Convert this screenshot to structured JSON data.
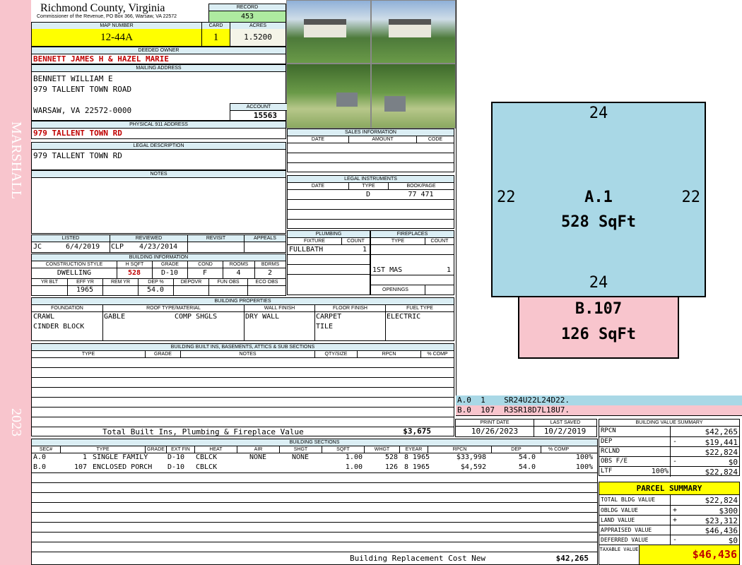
{
  "sidebar": {
    "owner_name": "MARSHALL",
    "year": "2023"
  },
  "header": {
    "county": "Richmond County, Virginia",
    "commissioner": "Commissioner of the Revenue, PO Box 366, Warsaw, VA 22572",
    "record_label": "RECORD",
    "record": "453",
    "map_number_label": "MAP NUMBER",
    "map_number": "12-44A",
    "card_label": "CARD",
    "card": "1",
    "acres_label": "ACRES",
    "acres": "1.5200"
  },
  "owner": {
    "deeded_owner_label": "DEEDED OWNER",
    "deeded_owner": "BENNETT JAMES H & HAZEL MARIE",
    "mailing_address_label": "MAILING ADDRESS",
    "mailing_line1": "BENNETT WILLIAM E",
    "mailing_line2": "979 TALLENT TOWN ROAD",
    "mailing_line3": "WARSAW, VA 22572-0000",
    "account_label": "ACCOUNT",
    "account": "15563",
    "physical_address_label": "PHYSICAL 911 ADDRESS",
    "physical_address": "979 TALLENT TOWN RD",
    "legal_description_label": "LEGAL DESCRIPTION",
    "legal_description": "979 TALLENT TOWN RD",
    "notes_label": "NOTES"
  },
  "sales": {
    "label": "SALES INFORMATION",
    "columns": [
      "DATE",
      "AMOUNT",
      "CODE"
    ]
  },
  "legal_instruments": {
    "label": "LEGAL INSTRUMENTS",
    "columns": [
      "DATE",
      "TYPE",
      "BOOK/PAGE"
    ],
    "row": {
      "date": "",
      "type": "D",
      "bookpage": "77 471"
    }
  },
  "review": {
    "listed_label": "LISTED",
    "reviewed_label": "REVIEWED",
    "revisit_label": "REVISIT",
    "appeals_label": "APPEALS",
    "listed_by": "JC",
    "listed_date": "6/4/2019",
    "reviewed_by": "CLP",
    "reviewed_date": "4/23/2014"
  },
  "building_info": {
    "label": "BUILDING INFORMATION",
    "cols1": [
      "CONSTRUCTION STYLE",
      "H SQFT",
      "GRADE",
      "COND",
      "ROOMS",
      "BDRMS"
    ],
    "style": "DWELLING",
    "hsqft": "528",
    "grade": "D-10",
    "cond": "F",
    "rooms": "4",
    "bdrms": "2",
    "cols2": [
      "YR BLT",
      "EFF YR",
      "REM YR",
      "DEP %",
      "DEPOVR",
      "FUN OBS",
      "ECO OBS"
    ],
    "eff_yr": "1965",
    "dep": "54.0"
  },
  "plumbing": {
    "label": "PLUMBING",
    "fixture_label": "FIXTURE",
    "count_label": "COUNT",
    "fixture": "FULLBATH",
    "count": "1"
  },
  "fireplaces": {
    "label": "FIREPLACES",
    "type_label": "TYPE",
    "count_label": "COUNT",
    "type": "1ST MAS",
    "count": "1",
    "openings_label": "OPENINGS"
  },
  "properties": {
    "label": "BUILDING PROPERTIES",
    "columns": [
      "FOUNDATION",
      "ROOF TYPE/MATERIAL",
      "WALL FINISH",
      "FLOOR FINISH",
      "FUEL TYPE"
    ],
    "foundation1": "CRAWL",
    "foundation2": "CINDER BLOCK",
    "roof_type": "GABLE",
    "roof_material": "COMP SHGLS",
    "wall": "DRY WALL",
    "floor1": "CARPET",
    "floor2": "TILE",
    "fuel": "ELECTRIC"
  },
  "builtins": {
    "label": "BUILDING BUILT INS, BASEMENTS, ATTICS & SUB SECTIONS",
    "columns": [
      "TYPE",
      "GRADE",
      "NOTES",
      "QTY/SIZE",
      "RPCN",
      "% COMP"
    ],
    "total_label": "Total Built Ins, Plumbing & Fireplace Value",
    "total_value": "$3,675"
  },
  "sections": {
    "label": "BUILDING SECTIONS",
    "columns": [
      "SEC#",
      "TYPE",
      "GRADE",
      "EXT FIN",
      "HEAT",
      "AIR",
      "SHGT",
      "SQFT",
      "WHGT",
      "EYEAR",
      "RPCN",
      "DEP",
      "% COMP"
    ],
    "rows": [
      {
        "sec": "A.0",
        "num": "1",
        "type": "SINGLE FAMILY",
        "grade": "D-10",
        "ext": "CBLCK",
        "heat": "NONE",
        "air": "NONE",
        "shgt": "1.00",
        "sqft": "528",
        "whgt": "8",
        "eyear": "1965",
        "rpcn": "$33,998",
        "dep": "54.0",
        "comp": "100%"
      },
      {
        "sec": "B.0",
        "num": "107",
        "type": "ENCLOSED PORCH",
        "grade": "D-10",
        "ext": "CBLCK",
        "heat": "",
        "air": "",
        "shgt": "1.00",
        "sqft": "126",
        "whgt": "8",
        "eyear": "1965",
        "rpcn": "$4,592",
        "dep": "54.0",
        "comp": "100%"
      }
    ],
    "replacement_label": "Building Replacement Cost New",
    "replacement_value": "$42,265"
  },
  "sketch": {
    "a_top": "24",
    "a_bottom": "24",
    "a_left": "22",
    "a_right": "22",
    "a_label": "A.1",
    "a_area": "528 SqFt",
    "b_label": "B.107",
    "b_area": "126 SqFt",
    "a_color": "#a9d8e6",
    "b_color": "#f8c5cd",
    "legend_a": "A.0  1    SR24U22L24D22.",
    "legend_b": "B.0  107  R3SR18D7L18U7."
  },
  "dates": {
    "print_label": "PRINT DATE",
    "saved_label": "LAST SAVED",
    "print_date": "10/26/2023",
    "last_saved": "10/2/2019"
  },
  "value_summary": {
    "label": "BUILDING VALUE SUMMARY",
    "rows": [
      {
        "label": "RPCN",
        "sign": "",
        "value": "$42,265"
      },
      {
        "label": "DEP",
        "sign": "-",
        "value": "$19,441"
      },
      {
        "label": "RCLND",
        "sign": "",
        "value": "$22,824"
      },
      {
        "label": "OBS F/E",
        "sign": "-",
        "value": "$0"
      },
      {
        "label": "LTF",
        "pct": "100%",
        "sign": "",
        "value": "$22,824"
      }
    ]
  },
  "parcel_summary": {
    "label": "PARCEL SUMMARY",
    "rows": [
      {
        "label": "TOTAL BLDG VALUE",
        "sign": "",
        "value": "$22,824"
      },
      {
        "label": "OBLDG VALUE",
        "sign": "+",
        "value": "$300"
      },
      {
        "label": "LAND VALUE",
        "sign": "+",
        "value": "$23,312"
      },
      {
        "label": "APPRAISED VALUE",
        "sign": "",
        "value": "$46,436"
      },
      {
        "label": "DEFERRED VALUE",
        "sign": "-",
        "value": "$0"
      }
    ],
    "taxable_label": "TAXABLE VALUE",
    "taxable_value": "$46,436",
    "accent": "#ffff00"
  }
}
